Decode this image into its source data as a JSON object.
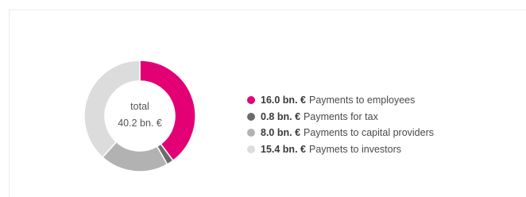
{
  "chart_data": {
    "type": "pie",
    "total_label": "total",
    "total_value": "40.2 bn. €",
    "slices": [
      {
        "value": 16.0,
        "value_label": "16.0 bn. €",
        "label": "Payments to employees",
        "color": "#e20074"
      },
      {
        "value": 0.8,
        "value_label": "0.8 bn. €",
        "label": "Payments for tax",
        "color": "#6b6b6b"
      },
      {
        "value": 8.0,
        "value_label": "8.0 bn. €",
        "label": "Payments to capital providers",
        "color": "#b2b2b2"
      },
      {
        "value": 15.4,
        "value_label": "15.4 bn. €",
        "label": "Paymets to investors",
        "color": "#dcdcdc"
      }
    ],
    "legend_position": "right"
  }
}
